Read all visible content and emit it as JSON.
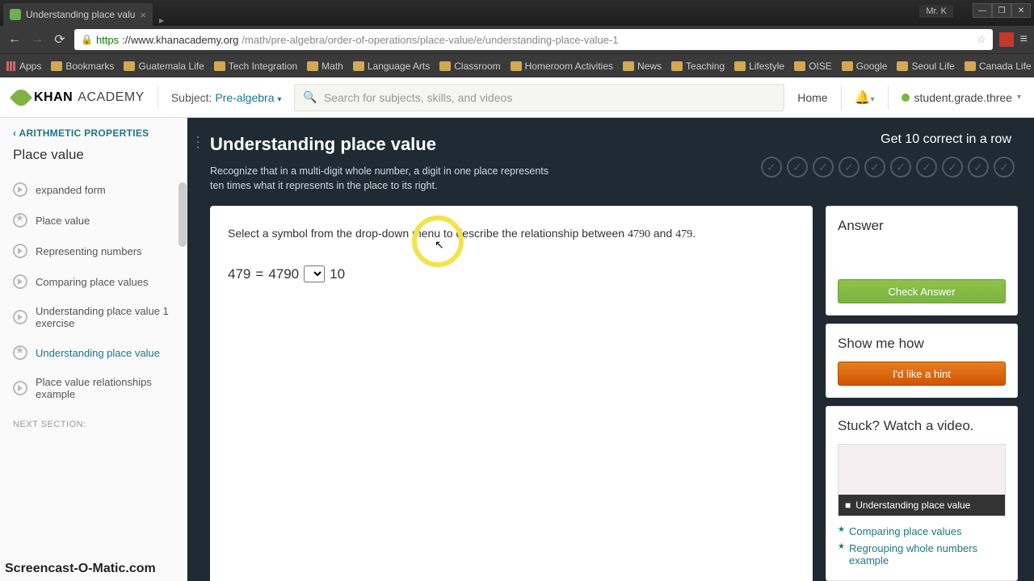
{
  "browser": {
    "tab_title": "Understanding place valu",
    "user_chip": "Mr. K",
    "url_proto": "https",
    "url_host": "://www.khanacademy.org",
    "url_path": "/math/pre-algebra/order-of-operations/place-value/e/understanding-place-value-1",
    "bookmarks": [
      "Apps",
      "Bookmarks",
      "Guatemala Life",
      "Tech Integration",
      "Math",
      "Language Arts",
      "Classroom",
      "Homeroom Activities",
      "News",
      "Teaching",
      "Lifestyle",
      "OISE",
      "Google",
      "Seoul Life",
      "Canada Life"
    ]
  },
  "khan_header": {
    "logo_bold": "KHAN",
    "logo_thin": "ACADEMY",
    "subject_label": "Subject:",
    "subject_value": "Pre-algebra",
    "search_placeholder": "Search for subjects, skills, and videos",
    "home": "Home",
    "username": "student.grade.three"
  },
  "sidebar": {
    "back": "ARITHMETIC PROPERTIES",
    "title": "Place value",
    "items": [
      {
        "label": "expanded form",
        "kind": "play"
      },
      {
        "label": "Place value",
        "kind": "star"
      },
      {
        "label": "Representing numbers",
        "kind": "play"
      },
      {
        "label": "Comparing place values",
        "kind": "play"
      },
      {
        "label": "Understanding place value 1 exercise",
        "kind": "play"
      },
      {
        "label": "Understanding place value",
        "kind": "star",
        "active": true
      },
      {
        "label": "Place value relationships example",
        "kind": "play"
      }
    ],
    "next_section": "NEXT SECTION:"
  },
  "content": {
    "title": "Understanding place value",
    "goal": "Get 10 correct in a row",
    "subtitle": "Recognize that in a multi-digit whole number, a digit in one place represents ten times what it represents in the place to its right.",
    "question_pre": "Select a symbol from the drop-down menu to describe the relationship between ",
    "question_n1": "4790",
    "question_mid": " and ",
    "question_n2": "479",
    "question_post": ".",
    "eq_lhs": "479",
    "eq_eq": "=",
    "eq_rhs": "4790",
    "eq_tail": "10"
  },
  "answer_col": {
    "answer_title": "Answer",
    "check_btn": "Check Answer",
    "showme_title": "Show me how",
    "hint_btn": "I'd like a hint",
    "stuck_title": "Stuck? Watch a video.",
    "video_label": "Understanding place value",
    "links": [
      "Comparing place values",
      "Regrouping whole numbers example"
    ]
  },
  "watermark": "Screencast-O-Matic.com"
}
